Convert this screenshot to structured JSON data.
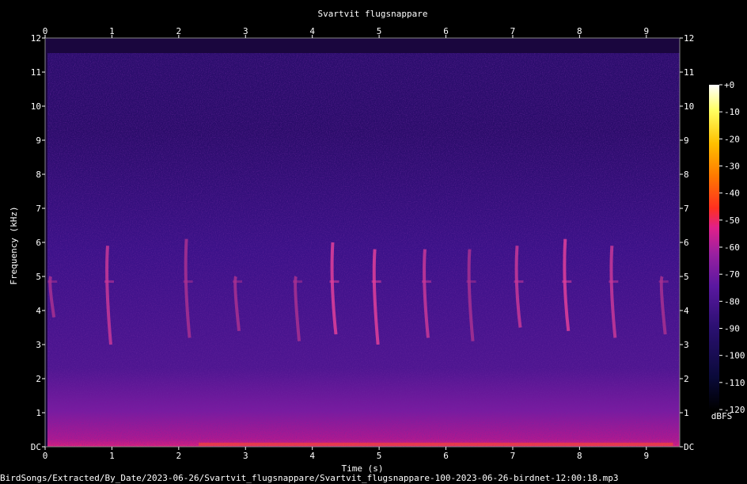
{
  "chart_data": {
    "type": "heatmap",
    "title": "Svartvit flugsnappare",
    "xlabel": "Time (s)",
    "ylabel": "Frequency (kHz)",
    "xlim": [
      0,
      9.5
    ],
    "ylim": [
      0,
      12
    ],
    "x_ticks": [
      "0",
      "1",
      "2",
      "3",
      "4",
      "5",
      "6",
      "7",
      "8",
      "9"
    ],
    "y_ticks": [
      "DC",
      "1",
      "2",
      "3",
      "4",
      "5",
      "6",
      "7",
      "8",
      "9",
      "10",
      "11",
      "12"
    ],
    "colorbar": {
      "label": "dBFS",
      "ticks": [
        "+0",
        "-10",
        "-20",
        "-30",
        "-40",
        "-50",
        "-60",
        "-70",
        "-80",
        "-90",
        "-100",
        "-110",
        "-120"
      ],
      "range": [
        -120,
        0
      ],
      "colormap": [
        "#000000",
        "#0a0a3a",
        "#2a1070",
        "#5a18a0",
        "#9a20a0",
        "#e0208a",
        "#ff3020",
        "#ff7a00",
        "#ffc000",
        "#ffff60",
        "#ffffff"
      ]
    },
    "calls": [
      {
        "t": 0.05,
        "f_low": 3.8,
        "f_high": 5.0,
        "level": -75
      },
      {
        "t": 0.9,
        "f_low": 3.0,
        "f_high": 5.9,
        "level": -70
      },
      {
        "t": 2.08,
        "f_low": 3.2,
        "f_high": 6.1,
        "level": -72
      },
      {
        "t": 2.82,
        "f_low": 3.4,
        "f_high": 5.0,
        "level": -72
      },
      {
        "t": 3.72,
        "f_low": 3.1,
        "f_high": 5.0,
        "level": -72
      },
      {
        "t": 4.27,
        "f_low": 3.3,
        "f_high": 6.0,
        "level": -68
      },
      {
        "t": 4.9,
        "f_low": 3.0,
        "f_high": 5.8,
        "level": -68
      },
      {
        "t": 5.65,
        "f_low": 3.2,
        "f_high": 5.8,
        "level": -70
      },
      {
        "t": 6.32,
        "f_low": 3.1,
        "f_high": 5.8,
        "level": -72
      },
      {
        "t": 7.03,
        "f_low": 3.5,
        "f_high": 5.9,
        "level": -70
      },
      {
        "t": 7.75,
        "f_low": 3.4,
        "f_high": 6.1,
        "level": -68
      },
      {
        "t": 8.45,
        "f_low": 3.2,
        "f_high": 5.9,
        "level": -70
      },
      {
        "t": 9.2,
        "f_low": 3.3,
        "f_high": 5.0,
        "level": -72
      }
    ]
  },
  "footer": {
    "filename": "BirdSongs/Extracted/By_Date/2023-06-26/Svartvit_flugsnappare/Svartvit_flugsnappare-100-2023-06-26-birdnet-12:00:18.mp3"
  }
}
